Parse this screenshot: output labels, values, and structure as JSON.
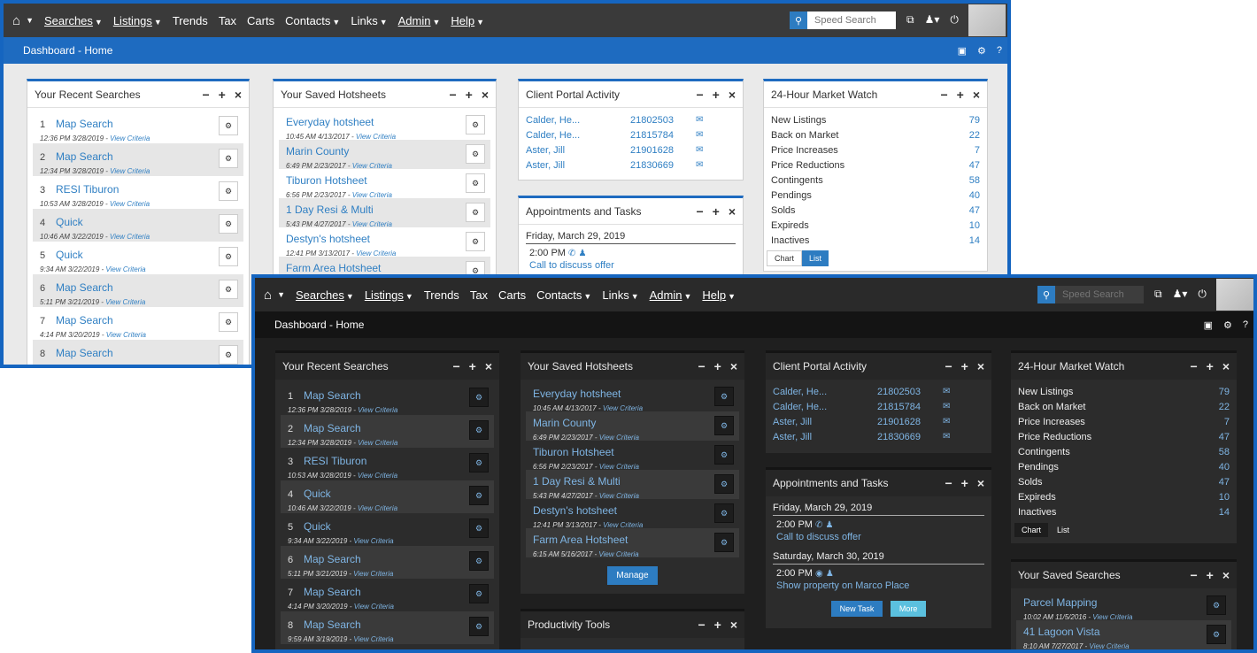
{
  "nav": {
    "items": [
      "Searches",
      "Listings",
      "Trends",
      "Tax",
      "Carts",
      "Contacts",
      "Links",
      "Admin",
      "Help"
    ],
    "search_placeholder": "Speed Search"
  },
  "subbar": {
    "title": "Dashboard - Home"
  },
  "panels": {
    "recent_searches": {
      "title": "Your Recent Searches",
      "items": [
        {
          "num": "1",
          "name": "Map Search",
          "time": "12:36 PM 3/28/2019",
          "link": "View Criteria"
        },
        {
          "num": "2",
          "name": "Map Search",
          "time": "12:34 PM 3/28/2019",
          "link": "View Criteria"
        },
        {
          "num": "3",
          "name": "RESI Tiburon",
          "time": "10:53 AM 3/28/2019",
          "link": "View Criteria"
        },
        {
          "num": "4",
          "name": "Quick",
          "time": "10:46 AM 3/22/2019",
          "link": "View Criteria"
        },
        {
          "num": "5",
          "name": "Quick",
          "time": "9:34 AM 3/22/2019",
          "link": "View Criteria"
        },
        {
          "num": "6",
          "name": "Map Search",
          "time": "5:11 PM 3/21/2019",
          "link": "View Criteria"
        },
        {
          "num": "7",
          "name": "Map Search",
          "time": "4:14 PM 3/20/2019",
          "link": "View Criteria"
        },
        {
          "num": "8",
          "name": "Map Search",
          "time": "9:59 AM 3/19/2019",
          "link": "View Criteria"
        }
      ]
    },
    "saved_hotsheets": {
      "title": "Your Saved Hotsheets",
      "items": [
        {
          "name": "Everyday hotsheet",
          "time": "10:45 AM 4/13/2017",
          "link": "View Criteria"
        },
        {
          "name": "Marin County",
          "time": "6:49 PM 2/23/2017",
          "link": "View Criteria"
        },
        {
          "name": "Tiburon Hotsheet",
          "time": "6:56 PM 2/23/2017",
          "link": "View Criteria"
        },
        {
          "name": "1 Day Resi & Multi",
          "time": "5:43 PM 4/27/2017",
          "link": "View Criteria"
        },
        {
          "name": "Destyn's hotsheet",
          "time": "12:41 PM 3/13/2017",
          "link": "View Criteria"
        },
        {
          "name": "Farm Area Hotsheet",
          "time": "6:15 AM 5/16/2017",
          "link": "View Criteria"
        }
      ],
      "manage_label": "Manage"
    },
    "client_portal": {
      "title": "Client Portal Activity",
      "rows": [
        {
          "name": "Calder, He...",
          "id": "21802503"
        },
        {
          "name": "Calder, He...",
          "id": "21815784"
        },
        {
          "name": "Aster, Jill",
          "id": "21901628"
        },
        {
          "name": "Aster, Jill",
          "id": "21830669"
        }
      ]
    },
    "appointments": {
      "title": "Appointments and Tasks",
      "day1": {
        "date": "Friday, March 29, 2019",
        "time": "2:00 PM",
        "desc": "Call to discuss offer"
      },
      "day2": {
        "date": "Saturday, March 30, 2019",
        "time": "2:00 PM",
        "desc": "Show property on Marco Place"
      },
      "new_task_label": "New Task",
      "more_label": "More"
    },
    "market_watch": {
      "title": "24-Hour Market Watch",
      "rows": [
        {
          "label": "New Listings",
          "value": "79"
        },
        {
          "label": "Back on Market",
          "value": "22"
        },
        {
          "label": "Price Increases",
          "value": "7"
        },
        {
          "label": "Price Reductions",
          "value": "47"
        },
        {
          "label": "Contingents",
          "value": "58"
        },
        {
          "label": "Pendings",
          "value": "40"
        },
        {
          "label": "Solds",
          "value": "47"
        },
        {
          "label": "Expireds",
          "value": "10"
        },
        {
          "label": "Inactives",
          "value": "14"
        }
      ],
      "chart_label": "Chart",
      "list_label": "List"
    },
    "productivity": {
      "title": "Productivity Tools"
    },
    "saved_searches": {
      "title": "Your Saved Searches",
      "items": [
        {
          "name": "Parcel Mapping",
          "time": "10:02 AM 11/5/2016",
          "link": "View Criteria"
        },
        {
          "name": "41 Lagoon Vista",
          "time": "8:10 AM 7/27/2017",
          "link": "View Criteria"
        }
      ]
    }
  },
  "colors": {
    "accent": "#1e6bc0",
    "link_light": "#2f7fc3",
    "link_dark": "#7fb5e4",
    "button": "#2d7cc1"
  }
}
